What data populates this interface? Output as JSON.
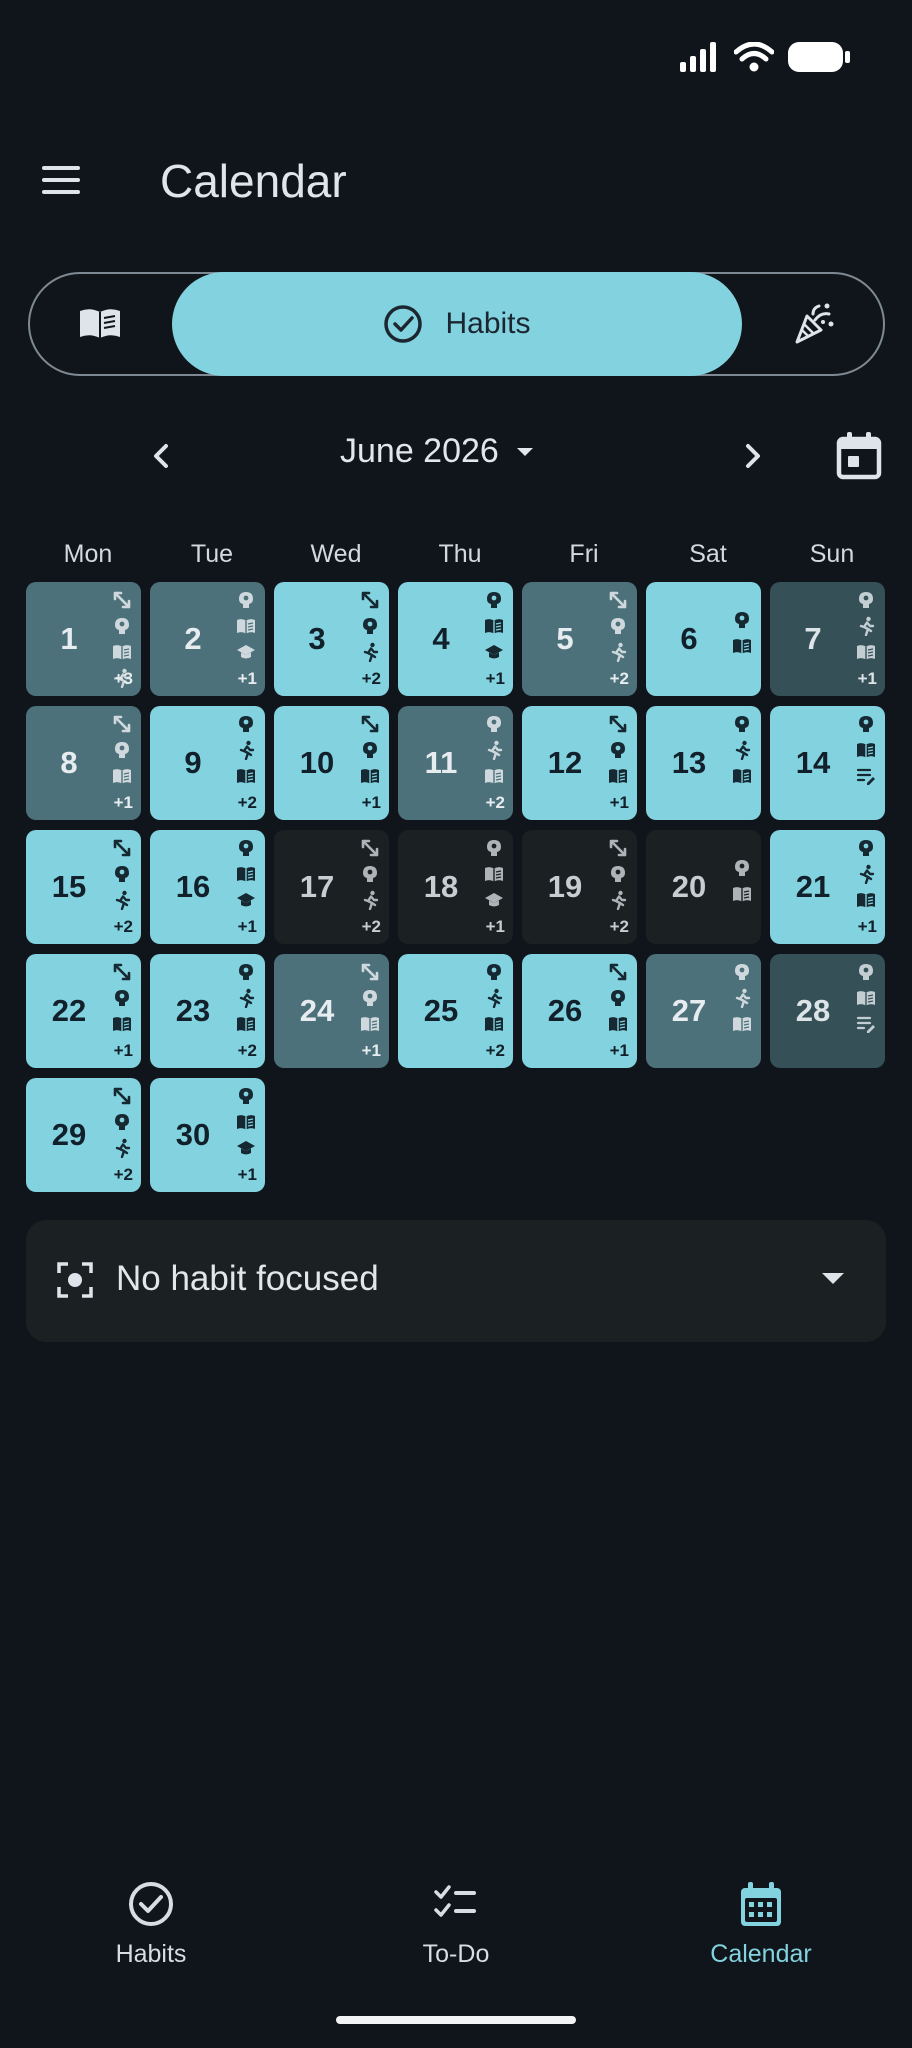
{
  "app": {
    "title": "Calendar",
    "accent_color": "#82d3df",
    "background_color": "#10151b"
  },
  "status_bar": {
    "icons": [
      "signal-icon",
      "wifi-icon",
      "battery-icon"
    ]
  },
  "segmented": {
    "left_icon": "book-icon",
    "selected_label": "Habits",
    "selected_icon": "check-circle-icon",
    "right_icon": "party-popper-icon"
  },
  "month_nav": {
    "label": "June 2026"
  },
  "weekdays": [
    "Mon",
    "Tue",
    "Wed",
    "Thu",
    "Fri",
    "Sat",
    "Sun"
  ],
  "days": [
    {
      "day": "1",
      "level": 2,
      "icons": [
        "expand",
        "brain",
        "book",
        "run"
      ],
      "more": "+3"
    },
    {
      "day": "2",
      "level": 2,
      "icons": [
        "brain",
        "book",
        "school"
      ],
      "more": "+1"
    },
    {
      "day": "3",
      "level": 3,
      "icons": [
        "expand",
        "brain",
        "run"
      ],
      "more": "+2"
    },
    {
      "day": "4",
      "level": 3,
      "icons": [
        "brain",
        "book",
        "school"
      ],
      "more": "+1"
    },
    {
      "day": "5",
      "level": 2,
      "icons": [
        "expand",
        "brain",
        "run"
      ],
      "more": "+2"
    },
    {
      "day": "6",
      "level": 3,
      "icons": [
        "brain",
        "book"
      ],
      "more": ""
    },
    {
      "day": "7",
      "level": 1,
      "icons": [
        "brain",
        "run",
        "book"
      ],
      "more": "+1"
    },
    {
      "day": "8",
      "level": 2,
      "icons": [
        "expand",
        "brain",
        "book"
      ],
      "more": "+1"
    },
    {
      "day": "9",
      "level": 3,
      "icons": [
        "brain",
        "run",
        "book"
      ],
      "more": "+2"
    },
    {
      "day": "10",
      "level": 3,
      "icons": [
        "expand",
        "brain",
        "book"
      ],
      "more": "+1"
    },
    {
      "day": "11",
      "level": 2,
      "icons": [
        "brain",
        "run",
        "book"
      ],
      "more": "+2"
    },
    {
      "day": "12",
      "level": 3,
      "icons": [
        "expand",
        "brain",
        "book"
      ],
      "more": "+1"
    },
    {
      "day": "13",
      "level": 3,
      "icons": [
        "brain",
        "run",
        "book"
      ],
      "more": ""
    },
    {
      "day": "14",
      "level": 3,
      "icons": [
        "brain",
        "book",
        "notes"
      ],
      "more": ""
    },
    {
      "day": "15",
      "level": 3,
      "icons": [
        "expand",
        "brain",
        "run"
      ],
      "more": "+2"
    },
    {
      "day": "16",
      "level": 3,
      "icons": [
        "brain",
        "book",
        "school"
      ],
      "more": "+1"
    },
    {
      "day": "17",
      "level": 0,
      "icons": [
        "expand",
        "brain",
        "run"
      ],
      "more": "+2"
    },
    {
      "day": "18",
      "level": 0,
      "icons": [
        "brain",
        "book",
        "school"
      ],
      "more": "+1"
    },
    {
      "day": "19",
      "level": 0,
      "icons": [
        "expand",
        "brain",
        "run"
      ],
      "more": "+2"
    },
    {
      "day": "20",
      "level": 0,
      "icons": [
        "brain",
        "book"
      ],
      "more": ""
    },
    {
      "day": "21",
      "level": 3,
      "icons": [
        "brain",
        "run",
        "book"
      ],
      "more": "+1"
    },
    {
      "day": "22",
      "level": 3,
      "icons": [
        "expand",
        "brain",
        "book"
      ],
      "more": "+1"
    },
    {
      "day": "23",
      "level": 3,
      "icons": [
        "brain",
        "run",
        "book"
      ],
      "more": "+2"
    },
    {
      "day": "24",
      "level": 2,
      "icons": [
        "expand",
        "brain",
        "book"
      ],
      "more": "+1"
    },
    {
      "day": "25",
      "level": 3,
      "icons": [
        "brain",
        "run",
        "book"
      ],
      "more": "+2"
    },
    {
      "day": "26",
      "level": 3,
      "icons": [
        "expand",
        "brain",
        "book"
      ],
      "more": "+1"
    },
    {
      "day": "27",
      "level": 2,
      "icons": [
        "brain",
        "run",
        "book"
      ],
      "more": ""
    },
    {
      "day": "28",
      "level": 1,
      "icons": [
        "brain",
        "book",
        "notes"
      ],
      "more": ""
    },
    {
      "day": "29",
      "level": 3,
      "icons": [
        "expand",
        "brain",
        "run"
      ],
      "more": "+2"
    },
    {
      "day": "30",
      "level": 3,
      "icons": [
        "brain",
        "book",
        "school"
      ],
      "more": "+1"
    }
  ],
  "first_weekday_offset": 0,
  "focus": {
    "label": "No habit focused",
    "icon": "focus-target-icon"
  },
  "bottom_nav": [
    {
      "label": "Habits",
      "icon": "check-circle-icon",
      "active": false
    },
    {
      "label": "To-Do",
      "icon": "checklist-icon",
      "active": false
    },
    {
      "label": "Calendar",
      "icon": "calendar-icon",
      "active": true
    }
  ],
  "bottom_nav_colors": {
    "active": "#82d3df",
    "inactive": "#d9dde1"
  }
}
